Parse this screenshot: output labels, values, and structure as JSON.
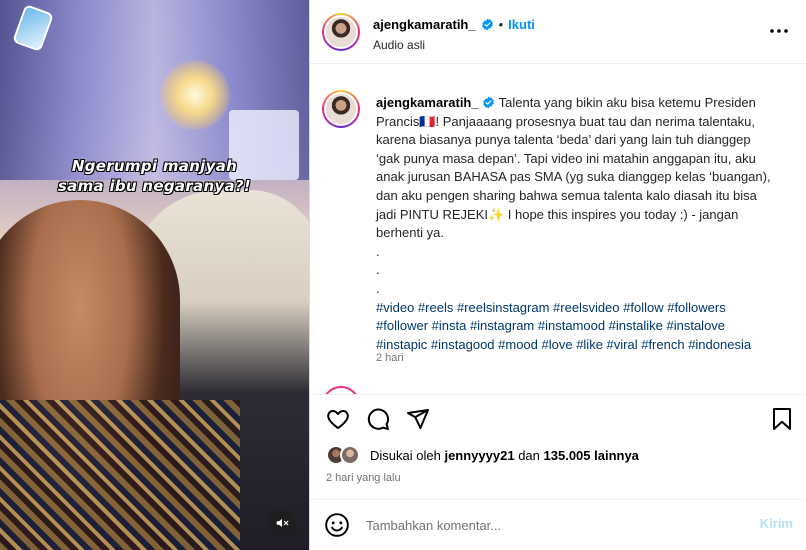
{
  "media": {
    "overlay_line1": "Ngerumpi manjyah",
    "overlay_line2": "sama ibu negaranya?!",
    "audio_icon": "speaker-muted-icon"
  },
  "header": {
    "username": "ajengkamaratih_",
    "separator": "•",
    "follow_label": "Ikuti",
    "subtitle": "Audio asli",
    "more_icon": "more-horizontal-icon"
  },
  "caption": {
    "username": "ajengkamaratih_",
    "lines": [
      "Talenta yang bikin aku bisa ketemu Presiden",
      "Prancis🇫🇷! Panjaaaang prosesnya buat tau dan nerima talentaku,",
      "karena biasanya punya talenta ‘beda’ dari yang lain tuh dianggep",
      "‘gak punya masa depan’. Tapi video ini matahin anggapan itu, aku",
      "anak jurusan BAHASA pas SMA (yg suka dianggep kelas ‘buangan),",
      "dan aku pengen sharing bahwa semua talenta kalo diasah itu bisa",
      "jadi PINTU REJEKI✨ I hope this inspires you today :) - jangan",
      "berhenti ya.",
      ".",
      ".",
      "."
    ],
    "hashtag_lines": [
      "#video #reels #reelsinstagram #reelsvideo #follow #followers",
      "#follower #insta #instagram #instamood #instalike #instalove",
      "#instapic #instagood #mood #love #like #viral #french #indonesia"
    ],
    "time": "2 hari"
  },
  "actions": {
    "like_icon": "heart-icon",
    "comment_icon": "comment-icon",
    "share_icon": "share-icon",
    "save_icon": "bookmark-icon",
    "liked_prefix": "Disukai oleh",
    "liked_user": "jennyyyy21",
    "liked_and": "dan",
    "liked_count": "135.005 lainnya",
    "post_time": "2 hari yang lalu"
  },
  "comment": {
    "emoji_icon": "emoji-icon",
    "placeholder": "Tambahkan komentar...",
    "post_label": "Kirim"
  },
  "colors": {
    "accent": "#0095f6",
    "verified": "#0095f6",
    "hashtag": "#00376b",
    "muted": "#737373",
    "post_disabled": "#b2dffc"
  }
}
